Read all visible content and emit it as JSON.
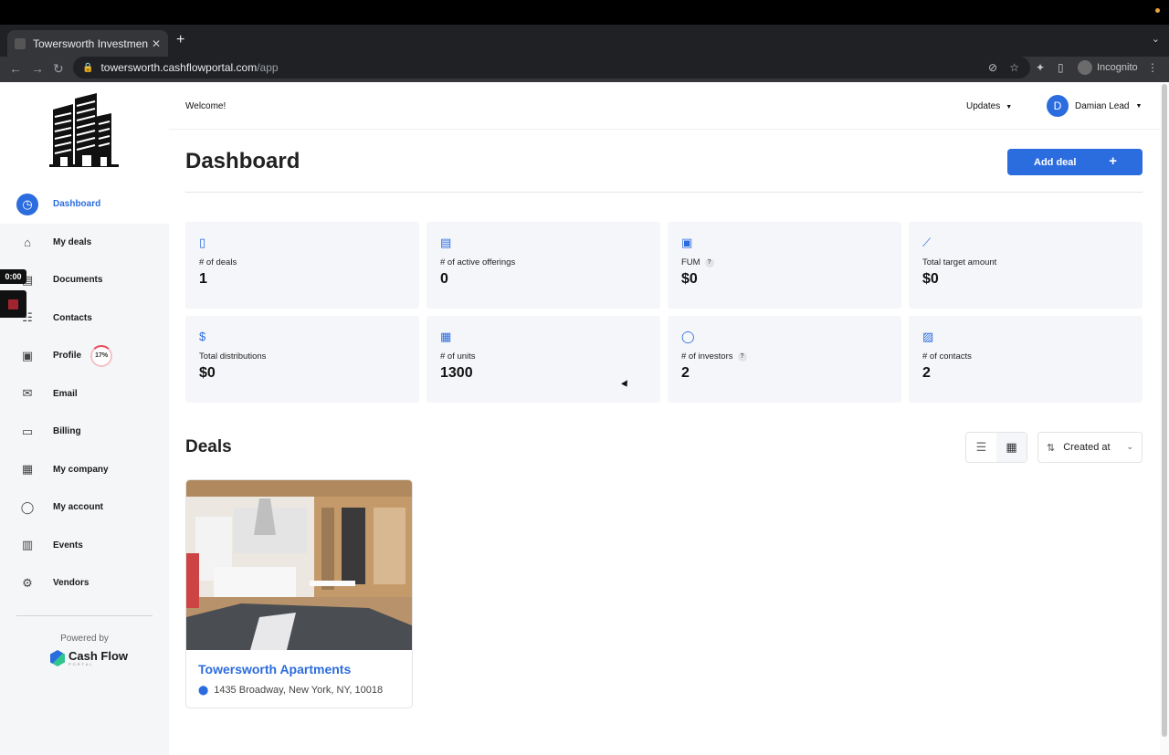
{
  "browser": {
    "tab_title": "Towersworth Investments | Inv",
    "new_tab": "+",
    "close": "✕",
    "url_host": "towersworth.cashflowportal.com",
    "url_path": "/app",
    "incognito": "Incognito"
  },
  "recorder": {
    "timer": "0:00"
  },
  "header": {
    "welcome": "Welcome!",
    "updates": "Updates",
    "user_initial": "D",
    "user_name": "Damian Lead"
  },
  "sidebar": {
    "items": [
      {
        "label": "Dashboard",
        "icon": "gauge-icon",
        "glyph": "◷",
        "active": true
      },
      {
        "label": "My deals",
        "icon": "bank-icon",
        "glyph": "⌂"
      },
      {
        "label": "Documents",
        "icon": "document-icon",
        "glyph": "▤"
      },
      {
        "label": "Contacts",
        "icon": "contacts-icon",
        "glyph": "☷"
      },
      {
        "label": "Profile",
        "icon": "profile-card-icon",
        "glyph": "▣"
      },
      {
        "label": "Email",
        "icon": "email-icon",
        "glyph": "✉"
      },
      {
        "label": "Billing",
        "icon": "credit-card-icon",
        "glyph": "▭"
      },
      {
        "label": "My company",
        "icon": "company-icon",
        "glyph": "▦"
      },
      {
        "label": "My account",
        "icon": "user-icon",
        "glyph": "◯"
      },
      {
        "label": "Events",
        "icon": "calendar-icon",
        "glyph": "▥"
      },
      {
        "label": "Vendors",
        "icon": "vendors-icon",
        "glyph": "⚙"
      }
    ],
    "profile_progress": "17%",
    "powered_by": "Powered by",
    "brand": "Cash Flow",
    "brand_sub": "PORTAL"
  },
  "main": {
    "title": "Dashboard",
    "add_deal": "Add deal",
    "add_plus": "+",
    "stats": [
      {
        "label": "# of deals",
        "value": "1",
        "icon": "clipboard-icon",
        "glyph": "▯",
        "help": false
      },
      {
        "label": "# of active offerings",
        "value": "0",
        "icon": "newspaper-icon",
        "glyph": "▤",
        "help": false
      },
      {
        "label": "FUM",
        "value": "$0",
        "icon": "safe-icon",
        "glyph": "▣",
        "help": true
      },
      {
        "label": "Total target amount",
        "value": "$0",
        "icon": "line-chart-icon",
        "glyph": "⟋",
        "help": false
      },
      {
        "label": "Total distributions",
        "value": "$0",
        "icon": "dollar-icon",
        "glyph": "$",
        "help": false
      },
      {
        "label": "# of units",
        "value": "1300",
        "icon": "building-icon",
        "glyph": "▦",
        "help": false
      },
      {
        "label": "# of investors",
        "value": "2",
        "icon": "user-icon",
        "glyph": "◯",
        "help": true
      },
      {
        "label": "# of contacts",
        "value": "2",
        "icon": "contact-book-icon",
        "glyph": "▨",
        "help": false
      }
    ],
    "help_mark": "?",
    "deals_title": "Deals",
    "sort_label": "Created at",
    "deals": [
      {
        "name": "Towersworth Apartments",
        "address": "1435 Broadway, New York, NY, 10018"
      }
    ]
  },
  "colors": {
    "accent": "#2b6cde",
    "sidebar_bg": "#f5f6f8",
    "card_bg": "#f4f6f9"
  }
}
